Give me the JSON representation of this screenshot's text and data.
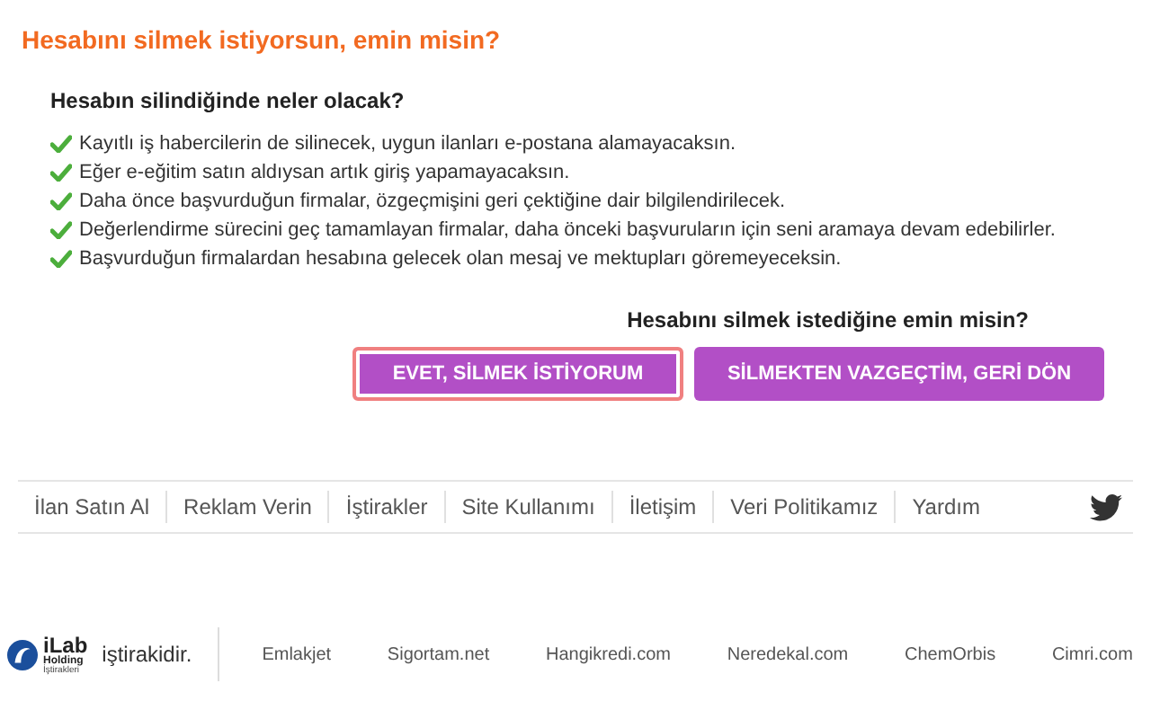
{
  "title": "Hesabını silmek istiyorsun, emin misin?",
  "consequences": {
    "heading": "Hesabın silindiğinde neler olacak?",
    "items": [
      "Kayıtlı iş habercilerin de silinecek, uygun ilanları e-postana alamayacaksın.",
      "Eğer e-eğitim satın aldıysan artık giriş yapamayacaksın.",
      "Daha önce başvurduğun firmalar, özgeçmişini geri çektiğine dair bilgilendirilecek.",
      "Değerlendirme sürecini geç tamamlayan firmalar, daha önceki başvuruların için seni aramaya devam edebilirler.",
      "Başvurduğun firmalardan hesabına gelecek olan mesaj ve mektupları göremeyeceksin."
    ]
  },
  "confirm": {
    "question": "Hesabını silmek istediğine emin misin?",
    "buttons": [
      {
        "label": "EVET, SİLMEK İSTİYORUM",
        "focused": true
      },
      {
        "label": "SİLMEKTEN VAZGEÇTİM, GERİ DÖN",
        "focused": false
      }
    ]
  },
  "footer_nav": [
    "İlan Satın Al",
    "Reklam Verin",
    "İştirakler",
    "Site Kullanımı",
    "İletişim",
    "Veri Politikamız",
    "Yardım"
  ],
  "affiliates": {
    "logo": {
      "name": "iLab",
      "subtitle": "Holding",
      "caption": "İştirakleri"
    },
    "text": "iştirakidir.",
    "links": [
      "Emlakjet",
      "Sigortam.net",
      "Hangikredi.com",
      "Neredekal.com",
      "ChemOrbis",
      "Cimri.com"
    ]
  }
}
